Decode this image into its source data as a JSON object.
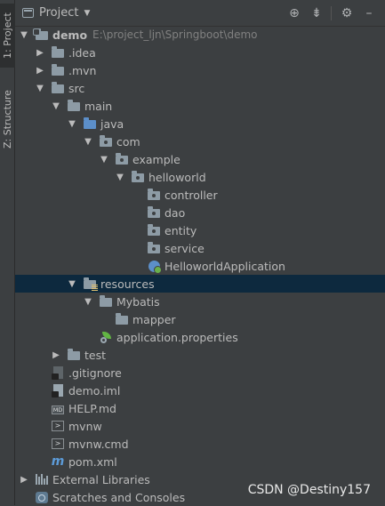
{
  "side_tabs": {
    "project": "1: Project",
    "structure": "Z: Structure"
  },
  "header": {
    "view_label": "Project"
  },
  "tree": [
    {
      "label": "demo",
      "path": "E:\\project_ljn\\Springboot\\demo"
    },
    {
      "label": ".idea"
    },
    {
      "label": ".mvn"
    },
    {
      "label": "src"
    },
    {
      "label": "main"
    },
    {
      "label": "java"
    },
    {
      "label": "com"
    },
    {
      "label": "example"
    },
    {
      "label": "helloworld"
    },
    {
      "label": "controller"
    },
    {
      "label": "dao"
    },
    {
      "label": "entity"
    },
    {
      "label": "service"
    },
    {
      "label": "HelloworldApplication"
    },
    {
      "label": "resources"
    },
    {
      "label": "Mybatis"
    },
    {
      "label": "mapper"
    },
    {
      "label": "application.properties"
    },
    {
      "label": "test"
    },
    {
      "label": ".gitignore"
    },
    {
      "label": "demo.iml"
    },
    {
      "label": "HELP.md"
    },
    {
      "label": "mvnw"
    },
    {
      "label": "mvnw.cmd"
    },
    {
      "label": "pom.xml"
    },
    {
      "label": "External Libraries"
    },
    {
      "label": "Scratches and Consoles"
    }
  ],
  "md_badge": "MD",
  "watermark": "CSDN @Destiny157"
}
